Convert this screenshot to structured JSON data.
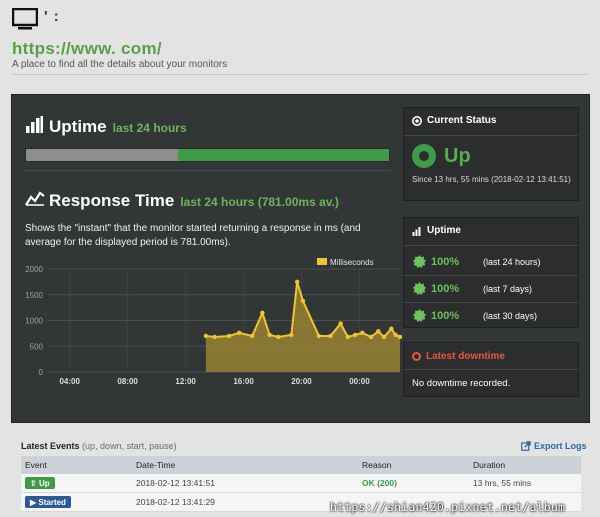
{
  "header": {
    "site_name": "'            :",
    "url": "https://www.                    com/",
    "tagline": "A place to find all the details about your monitors"
  },
  "uptime_section": {
    "title": "Uptime",
    "subtitle": "last 24 hours",
    "bar_green_fraction": 0.58
  },
  "response_section": {
    "title": "Response Time",
    "subtitle": "last 24 hours (781.00ms av.)",
    "description": "Shows the \"instant\" that the monitor started returning a response in ms (and average for the displayed period is 781.00ms)."
  },
  "chart_data": {
    "type": "area",
    "legend": "Milliseconds",
    "legend_position": "top-right",
    "x_ticks": [
      "04:00",
      "08:00",
      "12:00",
      "16:00",
      "20:00",
      "00:00"
    ],
    "y_ticks": [
      "2000",
      "1500",
      "1000",
      "500",
      "0"
    ],
    "ylim": [
      0,
      2000
    ],
    "xlim_hours": [
      2.5,
      26.8
    ],
    "x": [
      13.4,
      14.0,
      15.0,
      15.7,
      16.6,
      17.3,
      17.8,
      18.4,
      19.3,
      19.7,
      20.1,
      21.2,
      22.0,
      22.7,
      23.2,
      23.7,
      24.2,
      24.8,
      25.3,
      25.7,
      26.2,
      26.5,
      26.8
    ],
    "values": [
      700,
      680,
      700,
      760,
      700,
      1150,
      720,
      680,
      720,
      1750,
      1380,
      700,
      700,
      940,
      680,
      720,
      760,
      680,
      790,
      680,
      840,
      720,
      680
    ],
    "grid": true,
    "line_color": "#f2c430",
    "fill_color": "#8d7a33"
  },
  "current_status": {
    "title": "Current Status",
    "status": "Up",
    "since": "Since 13 hrs, 55 mins (2018-02-12 13:41:51)"
  },
  "uptime_box": {
    "title": "Uptime",
    "rows": [
      {
        "pct": "100%",
        "period": "(last 24 hours)"
      },
      {
        "pct": "100%",
        "period": "(last 7 days)"
      },
      {
        "pct": "100%",
        "period": "(last 30 days)"
      }
    ]
  },
  "downtime_box": {
    "title": "Latest downtime",
    "text": "No downtime recorded."
  },
  "events": {
    "title": "Latest Events",
    "filters": "(up, down, start, pause)",
    "export_label": "Export Logs",
    "columns": [
      "Event",
      "Date-Time",
      "Reason",
      "Duration"
    ],
    "rows": [
      {
        "event": "Up",
        "type": "up",
        "datetime": "2018-02-12 13:41:51",
        "reason": "OK (200)",
        "duration": "13 hrs, 55 mins"
      },
      {
        "event": "Started",
        "type": "started",
        "datetime": "2018-02-12 13:41:29",
        "reason": "",
        "duration": ""
      }
    ]
  },
  "watermark": "https://shian420.pixnet.net/album"
}
